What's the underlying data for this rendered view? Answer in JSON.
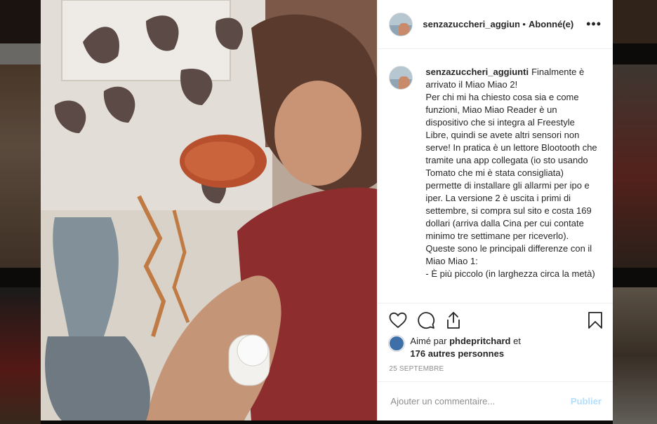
{
  "post": {
    "username": "senzazuccheri_aggiunti",
    "follow_status": "Abonné(e)",
    "separator": "•",
    "more_label": "•••",
    "caption_body": "Finalmente è arrivato il Miao Miao 2!\nPer chi mi ha chiesto cosa sia e come funzioni, Miao Miao Reader è un dispositivo che si integra al Freestyle Libre, quindi se avete altri sensori non serve! In pratica è un lettore Blootooth che tramite una app collegata (io sto usando Tomato che mi è stata consigliata) permette di installare gli allarmi per ipo e iper. La versione 2 è uscita i primi di settembre, si compra sul sito e costa 169 dollari (arriva dalla Cina per cui contate minimo tre settimane per riceverlo). Queste sono le principali differenze con il Miao Miao 1:\n- È più piccolo (in larghezza circa la metà)",
    "likes": {
      "prefix": "Aimé par",
      "liker": "phdepritchard",
      "joiner": "et",
      "others": "176 autres personnes"
    },
    "date": "25 SEPTEMBRE",
    "comment_placeholder": "Ajouter un commentaire...",
    "publish_label": "Publier"
  },
  "icons": {
    "like": "heart-icon",
    "comment": "comment-bubble-icon",
    "share": "share-icon",
    "save": "bookmark-icon"
  },
  "colors": {
    "text": "#262626",
    "muted": "#8e8e8e",
    "publish_disabled": "#b2dffc",
    "border": "#efefef"
  }
}
